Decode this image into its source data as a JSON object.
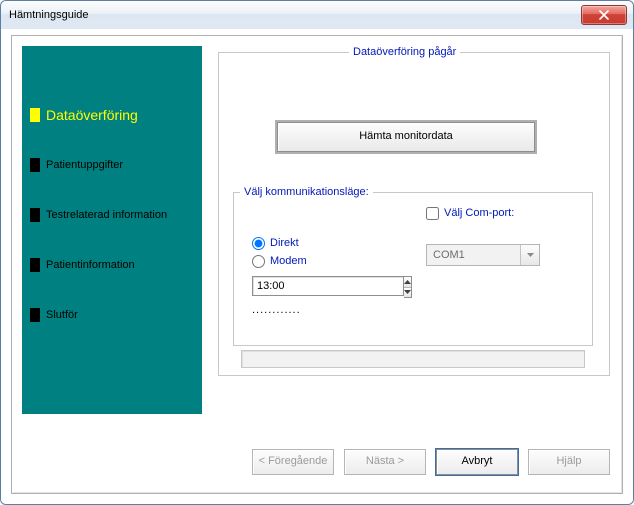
{
  "window": {
    "title": "Hämtningsguide"
  },
  "sidebar": {
    "items": [
      {
        "label": "Dataöverföring",
        "active": true
      },
      {
        "label": "Patientuppgifter",
        "active": false
      },
      {
        "label": "Testrelaterad information",
        "active": false
      },
      {
        "label": "Patientinformation",
        "active": false
      },
      {
        "label": "Slutför",
        "active": false
      }
    ]
  },
  "main": {
    "group_title": "Dataöverföring pågår",
    "fetch_button": "Hämta monitordata",
    "comm": {
      "legend": "Välj kommunikationsläge:",
      "radios": {
        "direct": "Direkt",
        "modem": "Modem",
        "selected": "direct"
      },
      "time_value": "13:00",
      "dotted": "............",
      "comport": {
        "checkbox_label": "Välj Com-port:",
        "checked": false,
        "selected": "COM1"
      }
    }
  },
  "buttons": {
    "prev": "< Föregående",
    "next": "Nästa >",
    "cancel": "Avbryt",
    "help": "Hjälp"
  }
}
